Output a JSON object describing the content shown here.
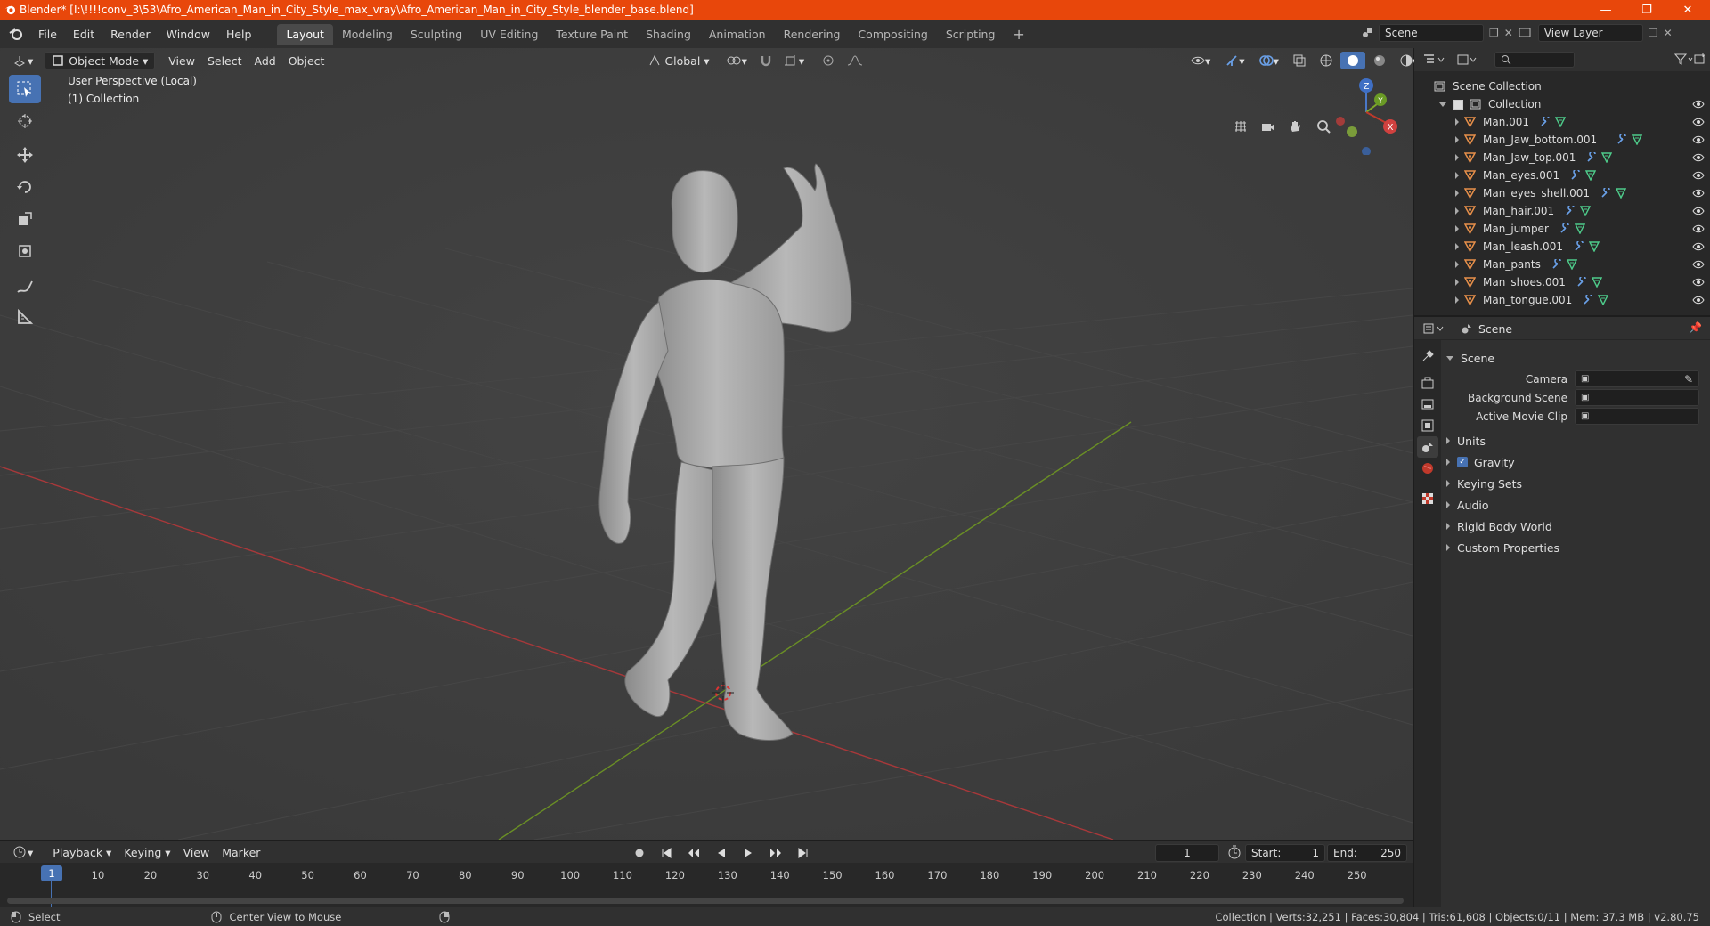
{
  "window": {
    "title": "Blender* [I:\\!!!!conv_3\\53\\Afro_American_Man_in_City_Style_max_vray\\Afro_American_Man_in_City_Style_blender_base.blend]",
    "minimize": "—",
    "maximize": "❐",
    "close": "✕"
  },
  "menu": {
    "items": [
      "File",
      "Edit",
      "Render",
      "Window",
      "Help"
    ]
  },
  "workspaces": [
    "Layout",
    "Modeling",
    "Sculpting",
    "UV Editing",
    "Texture Paint",
    "Shading",
    "Animation",
    "Rendering",
    "Compositing",
    "Scripting"
  ],
  "scene_field": "Scene",
  "view_layer_field": "View Layer",
  "viewport": {
    "mode": "Object Mode",
    "menus": [
      "View",
      "Select",
      "Add",
      "Object"
    ],
    "orientation": "Global",
    "overlay_title": "User Perspective (Local)",
    "overlay_collection": "(1) Collection",
    "gizmo": {
      "z": "Z",
      "y": "Y",
      "x": "X"
    }
  },
  "outliner": {
    "root": "Scene Collection",
    "collection": "Collection",
    "objects": [
      "Man.001",
      "Man_Jaw_bottom.001",
      "Man_Jaw_top.001",
      "Man_eyes.001",
      "Man_eyes_shell.001",
      "Man_hair.001",
      "Man_jumper",
      "Man_leash.001",
      "Man_pants",
      "Man_shoes.001",
      "Man_tongue.001"
    ],
    "search_placeholder": ""
  },
  "properties": {
    "context": "Scene",
    "panel_title": "Scene",
    "fields": [
      {
        "label": "Camera",
        "value": ""
      },
      {
        "label": "Background Scene",
        "value": ""
      },
      {
        "label": "Active Movie Clip",
        "value": ""
      }
    ],
    "sections": [
      "Units",
      "Gravity",
      "Keying Sets",
      "Audio",
      "Rigid Body World",
      "Custom Properties"
    ],
    "gravity_checked": true
  },
  "timeline": {
    "menus": [
      "Playback",
      "Keying",
      "View",
      "Marker"
    ],
    "current_frame": "1",
    "start_label": "Start:",
    "start": "1",
    "end_label": "End:",
    "end": "250",
    "ticks": [
      "1",
      "10",
      "20",
      "30",
      "40",
      "50",
      "60",
      "70",
      "80",
      "90",
      "100",
      "110",
      "120",
      "130",
      "140",
      "150",
      "160",
      "170",
      "180",
      "190",
      "200",
      "210",
      "220",
      "230",
      "240",
      "250"
    ]
  },
  "status": {
    "select": "Select",
    "center_view": "Center View to Mouse",
    "stats": "Collection | Verts:32,251 | Faces:30,804 | Tris:61,608 | Objects:0/11 | Mem: 37.3 MB | v2.80.75"
  },
  "colors": {
    "accent": "#4772b3",
    "titlebar": "#e8470b",
    "x_axis": "#c0392b",
    "y_axis": "#7fa82a"
  }
}
